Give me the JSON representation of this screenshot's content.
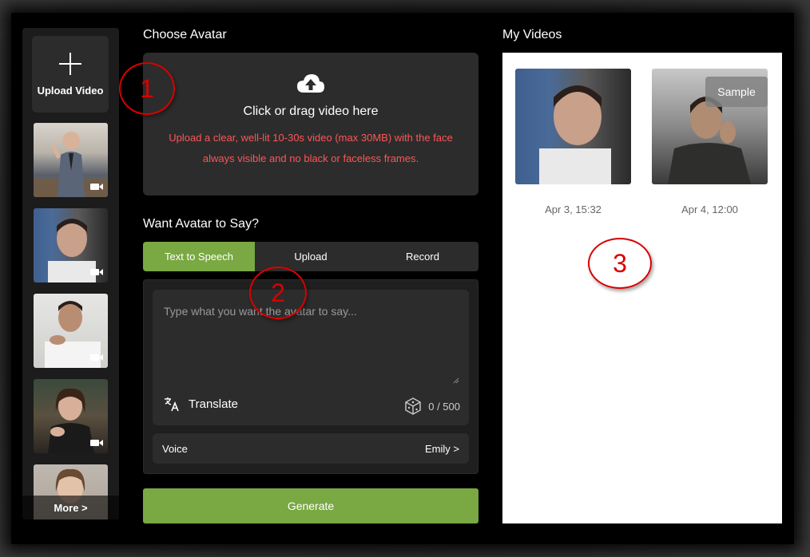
{
  "sidebar": {
    "upload_label": "Upload Video",
    "more_label": "More >",
    "thumbnails": [
      {
        "name": "avatar-thumb-1"
      },
      {
        "name": "avatar-thumb-2"
      },
      {
        "name": "avatar-thumb-3"
      },
      {
        "name": "avatar-thumb-4"
      },
      {
        "name": "avatar-thumb-5"
      }
    ]
  },
  "choose_avatar": {
    "title": "Choose Avatar",
    "dropzone_title": "Click or drag video here",
    "dropzone_hint": "Upload a clear, well-lit 10-30s video (max 30MB) with the face always visible and no black or faceless frames."
  },
  "say": {
    "title": "Want Avatar to Say?",
    "tabs": [
      "Text to Speech",
      "Upload",
      "Record"
    ],
    "active_tab": 0,
    "placeholder": "Type what you want the avatar to say...",
    "translate_label": "Translate",
    "counter": "0 / 500",
    "voice_label": "Voice",
    "voice_value": "Emily >"
  },
  "generate_label": "Generate",
  "my_videos": {
    "title": "My Videos",
    "items": [
      {
        "date": "Apr 3, 15:32",
        "sample": ""
      },
      {
        "date": "Apr 4, 12:00",
        "sample": "Sample"
      }
    ]
  },
  "callouts": [
    "1",
    "2",
    "3"
  ],
  "colors": {
    "accent": "#7aa843",
    "warning": "#ff5555",
    "callout": "#d90000"
  }
}
